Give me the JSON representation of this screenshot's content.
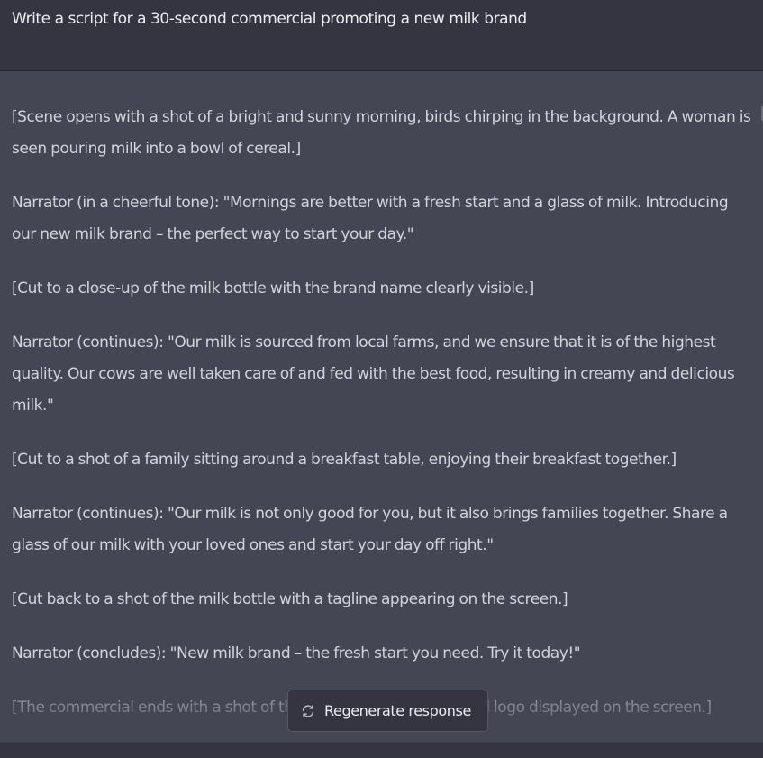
{
  "user_message": {
    "text": "Write a script for a 30-second commercial promoting a new milk brand"
  },
  "response": {
    "paragraphs": [
      "[Scene opens with a shot of a bright and sunny morning, birds chirping in the background. A woman is seen pouring milk into a bowl of cereal.]",
      "Narrator (in a cheerful tone): \"Mornings are better with a fresh start and a glass of milk. Introducing our new milk brand – the perfect way to start your day.\"",
      "[Cut to a close-up of the milk bottle with the brand name clearly visible.]",
      "Narrator (continues): \"Our milk is sourced from local farms, and we ensure that it is of the highest quality. Our cows are well taken care of and fed with the best food, resulting in creamy and delicious milk.\"",
      "[Cut to a shot of a family sitting around a breakfast table, enjoying their breakfast together.]",
      "Narrator (continues): \"Our milk is not only good for you, but it also brings families together. Share a glass of our milk with your loved ones and start your day off right.\"",
      "[Cut back to a shot of the milk bottle with a tagline appearing on the screen.]",
      "Narrator (concludes): \"New milk brand – the fresh start you need. Try it today!\"",
      "[The commercial ends with a shot of the milk bottle and the brand logo displayed on the screen.]"
    ]
  },
  "regenerate_button": {
    "label": "Regenerate response",
    "icon": "refresh-icon"
  },
  "colors": {
    "response_bg": "#444654",
    "user_bg": "#343541",
    "text": "#d1d5db",
    "button_border": "#565869"
  }
}
